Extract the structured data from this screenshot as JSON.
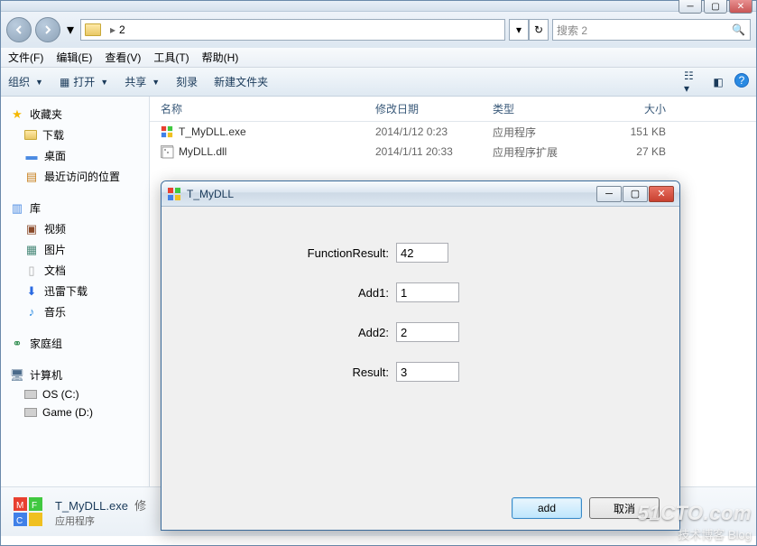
{
  "address": {
    "current": "2",
    "search_placeholder": "搜索 2"
  },
  "menubar": [
    "文件(F)",
    "编辑(E)",
    "查看(V)",
    "工具(T)",
    "帮助(H)"
  ],
  "toolbar": {
    "organize": "组织",
    "open": "打开",
    "share": "共享",
    "burn": "刻录",
    "newfolder": "新建文件夹"
  },
  "sidebar": {
    "favorites": {
      "label": "收藏夹",
      "items": [
        "下载",
        "桌面",
        "最近访问的位置"
      ]
    },
    "libraries": {
      "label": "库",
      "items": [
        "视频",
        "图片",
        "文档",
        "迅雷下载",
        "音乐"
      ]
    },
    "homegroup": {
      "label": "家庭组"
    },
    "computer": {
      "label": "计算机",
      "items": [
        "OS (C:)",
        "Game (D:)"
      ]
    }
  },
  "columns": {
    "name": "名称",
    "date": "修改日期",
    "type": "类型",
    "size": "大小"
  },
  "files": [
    {
      "name": "T_MyDLL.exe",
      "date": "2014/1/12 0:23",
      "type": "应用程序",
      "size": "151 KB"
    },
    {
      "name": "MyDLL.dll",
      "date": "2014/1/11 20:33",
      "type": "应用程序扩展",
      "size": "27 KB"
    }
  ],
  "details": {
    "name": "T_MyDLL.exe",
    "type": "应用程序",
    "modified_label": "修"
  },
  "dialog": {
    "title": "T_MyDLL",
    "fields": {
      "function_result_label": "FunctionResult:",
      "function_result_value": "42",
      "add1_label": "Add1:",
      "add1_value": "1",
      "add2_label": "Add2:",
      "add2_value": "2",
      "result_label": "Result:",
      "result_value": "3"
    },
    "buttons": {
      "add": "add",
      "cancel": "取消"
    }
  },
  "watermark": {
    "domain": "51CTO.com",
    "tagline": "技术博客   Blog"
  }
}
